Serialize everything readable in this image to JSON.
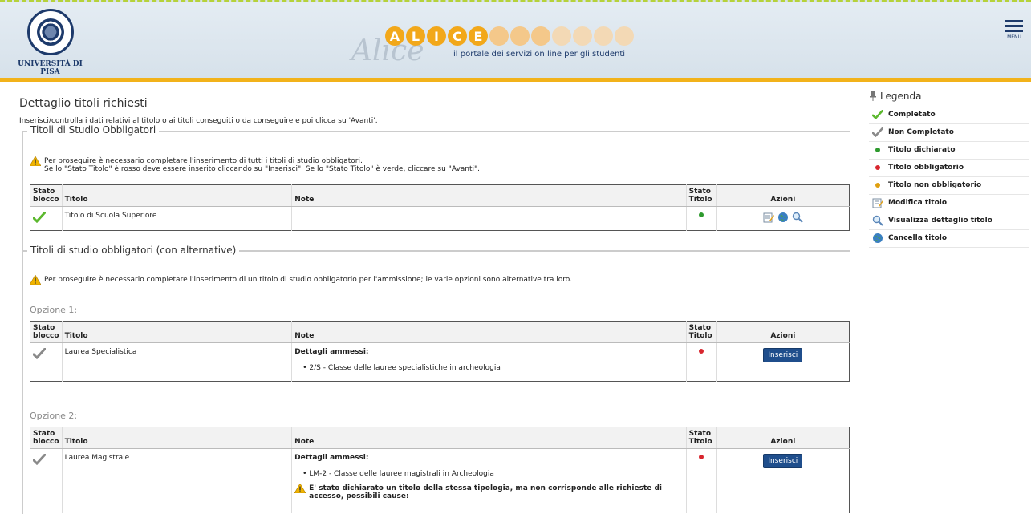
{
  "header": {
    "logo_text": "UNIVERSITÀ DI PISA",
    "logo_seal_text": "IN SUPREMÆ DIGNITATIS 1343",
    "app_script": "Alice",
    "app_letters": [
      "A",
      "L",
      "I",
      "C",
      "E"
    ],
    "tagline": "il portale dei servizi on line per gli studenti",
    "menu_label": "MENU"
  },
  "page": {
    "title": "Dettaglio titoli richiesti",
    "intro": "Inserisci/controlla i dati relativi al titolo o ai titoli conseguiti o da conseguire e poi clicca su 'Avanti'."
  },
  "section1": {
    "legend": "Titoli di Studio Obbligatori",
    "warn_line1": "Per proseguire è necessario completare l'inserimento di tutti i titoli di studio obbligatori.",
    "warn_line2": "Se lo \"Stato Titolo\" è rosso deve essere inserito cliccando su \"Inserisci\". Se lo \"Stato Titolo\" è verde, cliccare su \"Avanti\".",
    "headers": {
      "stato_blocco_1": "Stato",
      "stato_blocco_2": "blocco",
      "titolo": "Titolo",
      "note": "Note",
      "stato_titolo_1": "Stato",
      "stato_titolo_2": "Titolo",
      "azioni": "Azioni"
    },
    "row": {
      "titolo": "Titolo di Scuola Superiore",
      "note": "",
      "stato_blocco": "completato",
      "stato_titolo": "green"
    }
  },
  "section2": {
    "legend": "Titoli di studio obbligatori (con alternative)",
    "warn": "Per proseguire è necessario completare l'inserimento di un titolo di studio obbligatorio per l'ammissione; le varie opzioni sono alternative tra loro.",
    "option1": {
      "label": "Opzione 1:",
      "titolo": "Laurea Specialistica",
      "note_heading": "Dettagli ammessi:",
      "note_item": "2/S - Classe delle lauree specialistiche in archeologia",
      "stato_titolo": "red",
      "button": "Inserisci"
    },
    "option2": {
      "label": "Opzione 2:",
      "titolo": "Laurea Magistrale",
      "note_heading": "Dettagli ammessi:",
      "note_item": "LM-2 - Classe delle lauree magistrali in Archeologia",
      "note_warn": "E' stato dichiarato un titolo della stessa tipologia, ma non corrisponde alle richieste di accesso, possibili cause:",
      "stato_titolo": "red",
      "button": "Inserisci"
    }
  },
  "legend": {
    "title": "Legenda",
    "items": [
      {
        "label": "Completato",
        "icon": "check-green-icon"
      },
      {
        "label": "Non Completato",
        "icon": "check-grey-icon"
      },
      {
        "label": "Titolo dichiarato",
        "icon": "dot-green-icon"
      },
      {
        "label": "Titolo obbligatorio",
        "icon": "dot-red-icon"
      },
      {
        "label": "Titolo non obbligatorio",
        "icon": "dot-yellow-icon"
      },
      {
        "label": "Modifica titolo",
        "icon": "edit-icon"
      },
      {
        "label": "Visualizza dettaglio titolo",
        "icon": "magnifier-icon"
      },
      {
        "label": "Cancella titolo",
        "icon": "globe-delete-icon"
      }
    ]
  },
  "colors": {
    "accent": "#f2b21a",
    "button": "#1f4e8c",
    "green": "#2e9a2e",
    "red": "#d8262e",
    "yellow": "#e0a010"
  }
}
